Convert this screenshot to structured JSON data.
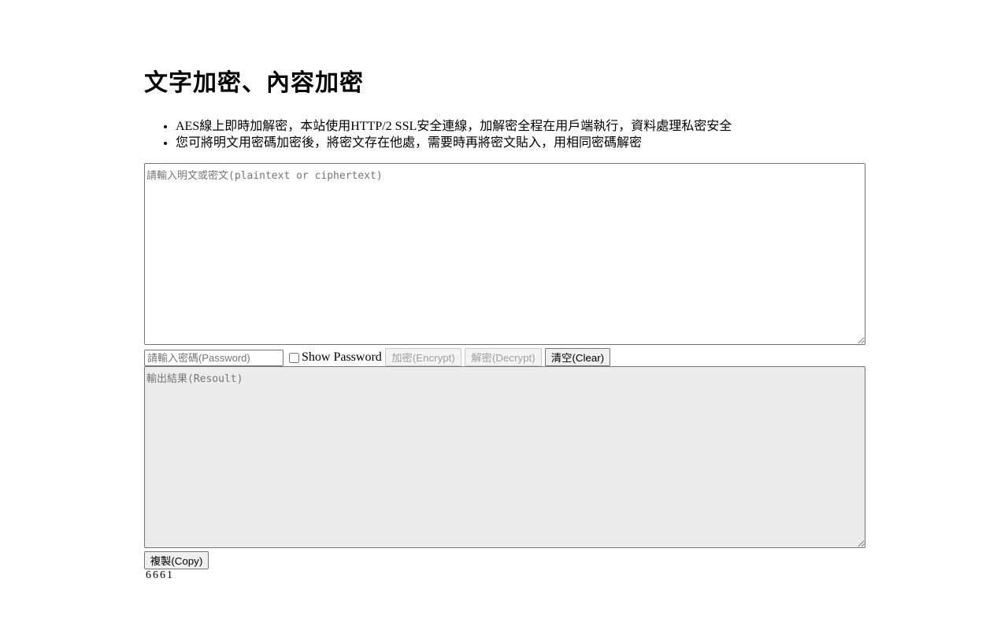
{
  "page": {
    "title": "文字加密、內容加密",
    "info_items": [
      "AES線上即時加解密，本站使用HTTP/2 SSL安全連線，加解密全程在用戶端執行，資料處理私密安全",
      "您可將明文用密碼加密後，將密文存在他處，需要時再將密文貼入，用相同密碼解密"
    ]
  },
  "input": {
    "placeholder": "請輸入明文或密文(plaintext or ciphertext)",
    "value": ""
  },
  "controls": {
    "password_placeholder": "請輸入密碼(Password)",
    "password_value": "",
    "show_password_label": "Show Password",
    "show_password_checked": false,
    "encrypt_label": "加密(Encrypt)",
    "encrypt_disabled": true,
    "decrypt_label": "解密(Decrypt)",
    "decrypt_disabled": true,
    "clear_label": "清空(Clear)"
  },
  "output": {
    "placeholder": "輸出結果(Resoult)",
    "value": ""
  },
  "copy_label": "複製(Copy)",
  "counter": "6661"
}
